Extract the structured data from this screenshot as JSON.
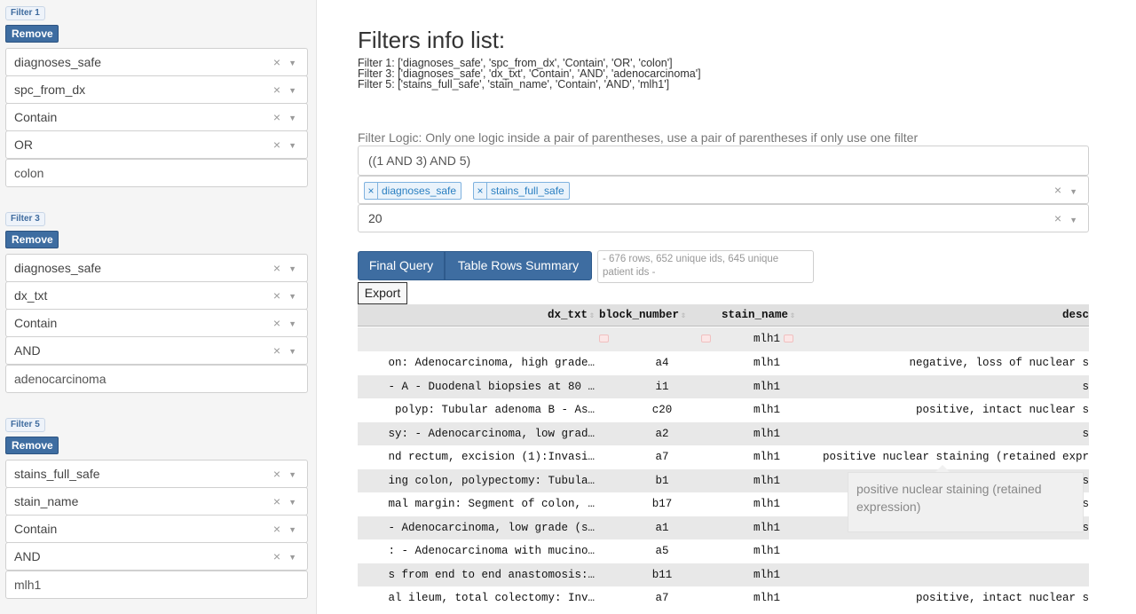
{
  "filters": [
    {
      "tag": "Filter 1",
      "remove_label": "Remove",
      "selects": [
        "diagnoses_safe",
        "spc_from_dx",
        "Contain",
        "OR"
      ],
      "value": "colon"
    },
    {
      "tag": "Filter 3",
      "remove_label": "Remove",
      "selects": [
        "diagnoses_safe",
        "dx_txt",
        "Contain",
        "AND"
      ],
      "value": "adenocarcinoma"
    },
    {
      "tag": "Filter 5",
      "remove_label": "Remove",
      "selects": [
        "stains_full_safe",
        "stain_name",
        "Contain",
        "AND"
      ],
      "value": "mlh1"
    }
  ],
  "icons": {
    "clear": "×",
    "caret": "▼",
    "sort": "⇕"
  },
  "main": {
    "title": "Filters info list:",
    "info_lines": [
      "Filter 1: ['diagnoses_safe', 'spc_from_dx', 'Contain', 'OR', 'colon']",
      "Filter 3: ['diagnoses_safe', 'dx_txt', 'Contain', 'AND', 'adenocarcinoma']",
      "Filter 5: ['stains_full_safe', 'stain_name', 'Contain', 'AND', 'mlh1']"
    ],
    "logic_label": "Filter Logic: Only one logic inside a pair of parentheses, use a pair of parentheses if only use one filter",
    "logic_value": "((1 AND 3) AND 5)",
    "tables": [
      "diagnoses_safe",
      "stains_full_safe"
    ],
    "rows_value": "20",
    "final_query_label": "Final Query",
    "summary_label": "Table Rows Summary",
    "status": "- 676 rows, 652 unique ids, 645 unique patient ids -",
    "export_label": "Export"
  },
  "table": {
    "columns": [
      "dx_txt",
      "block_number",
      "stain_name",
      "desc"
    ],
    "filter_values": [
      "",
      "",
      "mlh1",
      ""
    ],
    "rows": [
      [
        "on: Adenocarcinoma, high grade…",
        "a4",
        "mlh1",
        "negative, loss of nuclear s"
      ],
      [
        "- A - Duodenal biopsies at 80 …",
        "i1",
        "mlh1",
        "s"
      ],
      [
        " polyp: Tubular adenoma B - As…",
        "c20",
        "mlh1",
        "positive, intact nuclear s"
      ],
      [
        "sy: - Adenocarcinoma, low grad…",
        "a2",
        "mlh1",
        "s"
      ],
      [
        "nd rectum, excision (1):Invasi…",
        "a7",
        "mlh1",
        "positive nuclear staining (retained expr"
      ],
      [
        "ing colon, polypectomy: Tubula…",
        "b1",
        "mlh1",
        "s"
      ],
      [
        "mal margin: Segment of colon, …",
        "b17",
        "mlh1",
        "s"
      ],
      [
        "- Adenocarcinoma, low grade (s…",
        "a1",
        "mlh1",
        "s"
      ],
      [
        ": - Adenocarcinoma with mucino…",
        "a5",
        "mlh1",
        ""
      ],
      [
        "s from end to end anastomosis:…",
        "b11",
        "mlh1",
        ""
      ],
      [
        "al ileum, total colectomy: Inv…",
        "a7",
        "mlh1",
        "positive, intact nuclear s"
      ]
    ]
  },
  "tooltip": "positive nuclear staining (retained expression)"
}
